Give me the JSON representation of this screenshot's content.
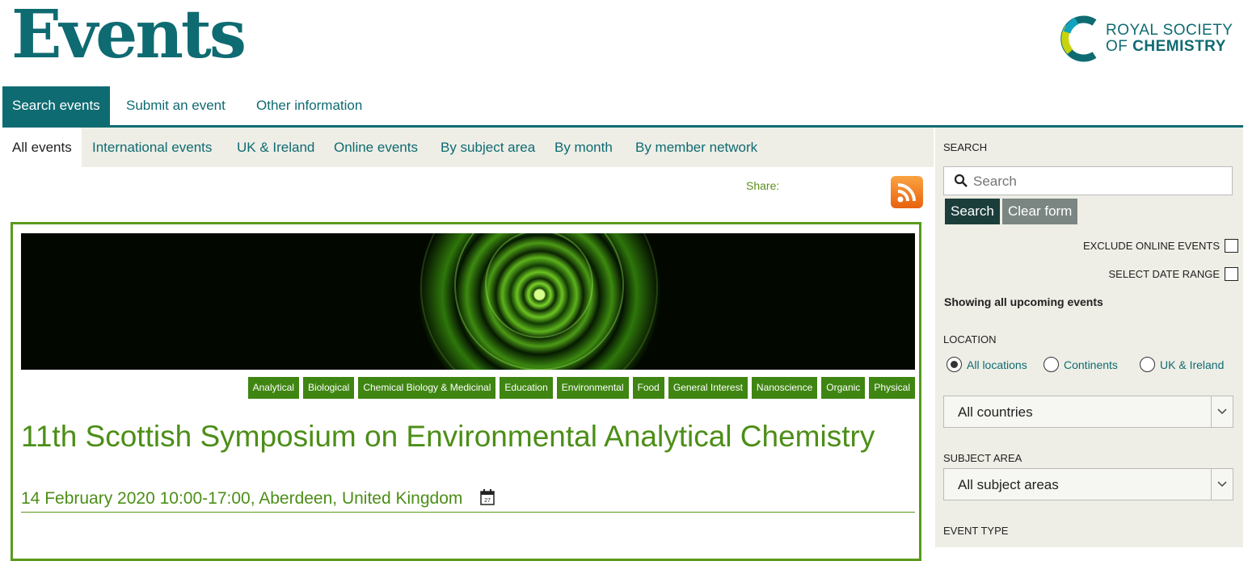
{
  "header": {
    "brand": "Events",
    "org_line1": "ROYAL SOCIETY",
    "org_line2_prefix": "OF ",
    "org_line2_bold": "CHEMISTRY"
  },
  "main_nav": [
    "Search events",
    "Submit an event",
    "Other information"
  ],
  "sub_nav": [
    "All events",
    "International events",
    "UK & Ireland",
    "Online events",
    "By subject area",
    "By month",
    "By member network"
  ],
  "share_label": "Share:",
  "event": {
    "tags": [
      "Analytical",
      "Biological",
      "Chemical Biology & Medicinal",
      "Education",
      "Environmental",
      "Food",
      "General Interest",
      "Nanoscience",
      "Organic",
      "Physical"
    ],
    "title": "11th Scottish Symposium on Environmental Analytical Chemistry",
    "date_location": "14 February 2020 10:00-17:00, Aberdeen, United Kingdom",
    "calendar_day": "27"
  },
  "sidebar": {
    "search_heading": "SEARCH",
    "search_placeholder": "Search",
    "search_button": "Search",
    "clear_button": "Clear form",
    "exclude_online": "EXCLUDE ONLINE EVENTS",
    "select_date_range": "SELECT DATE RANGE",
    "showing": "Showing all upcoming events",
    "location_heading": "LOCATION",
    "location_options": [
      "All locations",
      "Continents",
      "UK & Ireland"
    ],
    "location_selected": "All locations",
    "country_select": "All countries",
    "subject_heading": "SUBJECT AREA",
    "subject_select": "All subject areas",
    "event_type_heading": "EVENT TYPE"
  },
  "colors": {
    "brand_teal": "#0f6b72",
    "event_green": "#4c8e17",
    "tag_green": "#3f8512",
    "sidebar_bg": "#eeeee6"
  }
}
